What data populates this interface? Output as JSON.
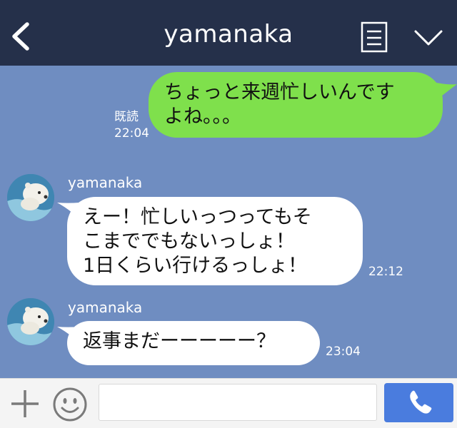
{
  "header": {
    "title": "yamanaka",
    "back_icon": "chevron-left-icon",
    "memo_icon": "note-icon",
    "menu_icon": "chevron-down-icon",
    "background": "#25304a"
  },
  "chat": {
    "background": "#6f8dc1",
    "messages": [
      {
        "side": "mine",
        "lines": [
          "ちょっと来週忙しいんです",
          "よね。。。"
        ],
        "read_label": "既読",
        "time": "22:04",
        "bubble_color": "#7fe04c"
      },
      {
        "side": "theirs",
        "sender": "yamanaka",
        "lines": [
          "えー！忙しいっつってもそ",
          "こまででもないっしょ！",
          "1日くらい行けるっしょ！"
        ],
        "time": "22:12",
        "bubble_color": "#ffffff"
      },
      {
        "side": "theirs",
        "sender": "yamanaka",
        "lines": [
          "返事まだーーーーー？"
        ],
        "time": "23:04",
        "bubble_color": "#ffffff"
      }
    ]
  },
  "footer": {
    "plus_icon": "plus-icon",
    "emoji_icon": "smiley-icon",
    "input_value": "",
    "call_icon": "phone-icon",
    "call_color": "#4a7cde"
  }
}
